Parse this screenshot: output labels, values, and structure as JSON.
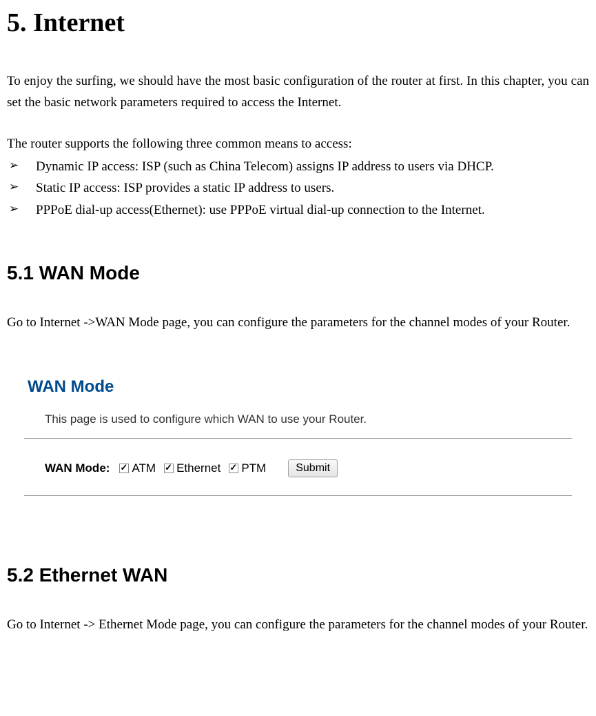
{
  "heading_main": "5. Internet",
  "intro": "To enjoy the surfing, we should have the most basic configuration of the router at first. In this chapter, you can set the basic network parameters required to access the Internet.",
  "access_intro": "The router supports the following three common means to access:",
  "bullets": {
    "b1": "Dynamic IP access: ISP (such as China Telecom) assigns IP address to users via DHCP.",
    "b2": "Static IP access: ISP provides a static IP address to users.",
    "b3": "PPPoE dial-up access(Ethernet): use PPPoE virtual dial-up connection to the Internet."
  },
  "section_51": {
    "heading": "5.1 WAN Mode",
    "para": "Go to Internet ->WAN Mode page, you can configure the parameters for the channel modes of your Router."
  },
  "wan_panel": {
    "title": "WAN Mode",
    "desc": "This page is used to configure which WAN to use your Router.",
    "label": "WAN Mode:",
    "opt_atm": "ATM",
    "opt_eth": "Ethernet",
    "opt_ptm": "PTM",
    "submit": "Submit"
  },
  "section_52": {
    "heading": "5.2 Ethernet WAN",
    "para": "Go to Internet -> Ethernet Mode page, you can configure the parameters for the channel modes of your Router."
  }
}
